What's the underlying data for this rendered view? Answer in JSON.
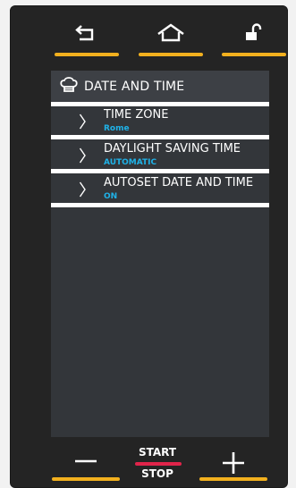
{
  "topbar": {
    "back_icon": "back-arrow-icon",
    "home_icon": "home-icon",
    "lock_icon": "unlocked-padlock-icon"
  },
  "screen": {
    "header_icon": "chef-hat-icon",
    "title": "DATE AND TIME",
    "items": [
      {
        "label": "TIME ZONE",
        "value": "Rome",
        "icon": "chevron-right-icon"
      },
      {
        "label": "DAYLIGHT SAVING TIME",
        "value": "AUTOMATIC",
        "icon": "chevron-right-icon"
      },
      {
        "label": "AUTOSET DATE AND TIME",
        "value": "ON",
        "icon": "chevron-right-icon"
      }
    ]
  },
  "bottombar": {
    "minus_icon": "minus-icon",
    "plus_icon": "plus-icon",
    "start_label": "START",
    "stop_label": "STOP"
  },
  "colors": {
    "accent": "#f2b01e",
    "value_text": "#1fb2e8",
    "start_stop_bar": "#e0244a",
    "panel_background": "#242424",
    "screen_background": "#33363a"
  }
}
